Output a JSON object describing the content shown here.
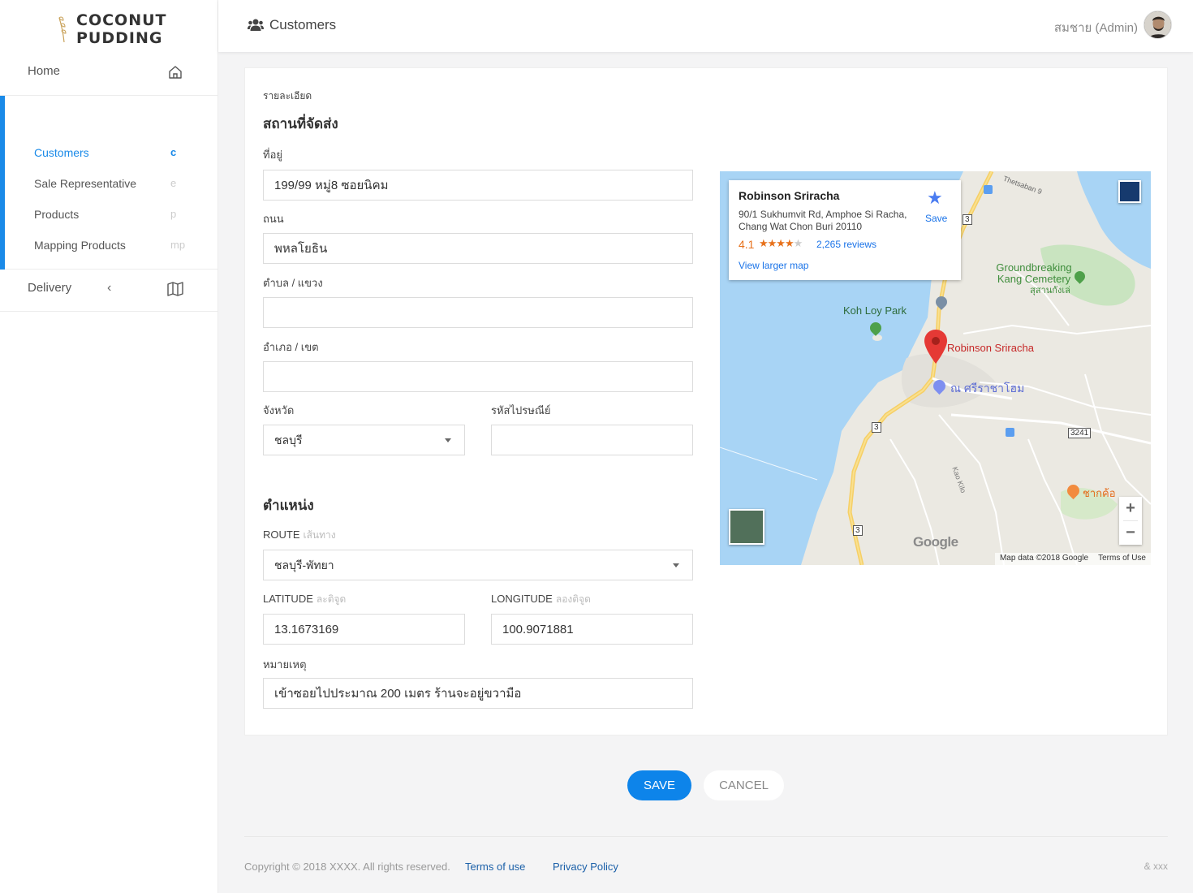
{
  "brand": {
    "line1": "COCONUT",
    "line2": "PUDDING"
  },
  "sidebar": {
    "home": "Home",
    "items": [
      {
        "label": "Customers",
        "abbr": "c"
      },
      {
        "label": "Sale Representative",
        "abbr": "e"
      },
      {
        "label": "Products",
        "abbr": "p"
      },
      {
        "label": "Mapping Products",
        "abbr": "mp"
      }
    ],
    "delivery": "Delivery",
    "active_color": "#1a8ae8"
  },
  "header": {
    "title": "Customers",
    "user": "สมชาย (Admin)"
  },
  "form": {
    "detail_label": "รายละเอียด",
    "shipping_title": "สถานที่จัดส่ง",
    "address_label": "ที่อยู่",
    "address_value": "199/99 หมู่8 ซอยนิคม",
    "road_label": "ถนน",
    "road_value": "พหลโยธิน",
    "subdistrict_label": "ตำบล / แขวง",
    "subdistrict_value": "",
    "district_label": "อำเภอ / เขต",
    "district_value": "",
    "province_label": "จังหวัด",
    "province_value": "ชลบุรี",
    "postcode_label": "รหัสไปรษณีย์",
    "postcode_value": "",
    "position_title": "ตำแหน่ง",
    "route_label": "ROUTE",
    "route_sub": "เส้นทาง",
    "route_value": "ชลบุรี-พัทยา",
    "lat_label": "LATITUDE",
    "lat_sub": "ละติจูด",
    "lat_value": "13.1673169",
    "lng_label": "LONGITUDE",
    "lng_sub": "ลองติจูด",
    "lng_value": "100.9071881",
    "note_label": "หมายเหตุ",
    "note_value": "เข้าซอยไปประมาณ 200 เมตร ร้านจะอยู่ขวามือ"
  },
  "map": {
    "place_name": "Robinson Sriracha",
    "address": "90/1 Sukhumvit Rd, Amphoe Si Racha, Chang Wat Chon Buri 20110",
    "rating": "4.1",
    "rating_value": 4.1,
    "reviews": "2,265 reviews",
    "larger_map": "View larger map",
    "save": "Save",
    "labels": {
      "cemetery_en": "Groundbreaking Kang Cemetery",
      "cemetery_th": "สุสานกังเล่",
      "park": "Koh Loy Park",
      "pin": "Robinson Sriracha",
      "hotel": "ณ ศรีราชาโฮม",
      "restaurant": "ชากค้อ",
      "thetsaban": "Thetsaban 9",
      "kao_kilo": "Kao Kilo",
      "route3": "3",
      "route3241": "3241"
    },
    "footer_data": "Map data ©2018 Google",
    "footer_terms": "Terms of Use",
    "google": "Google"
  },
  "actions": {
    "save": "SAVE",
    "cancel": "CANCEL"
  },
  "footer": {
    "copyright": "Copyright © 2018 XXXX. All rights reserved.",
    "terms": "Terms of use",
    "privacy": "Privacy Policy",
    "right": "& xxx"
  }
}
